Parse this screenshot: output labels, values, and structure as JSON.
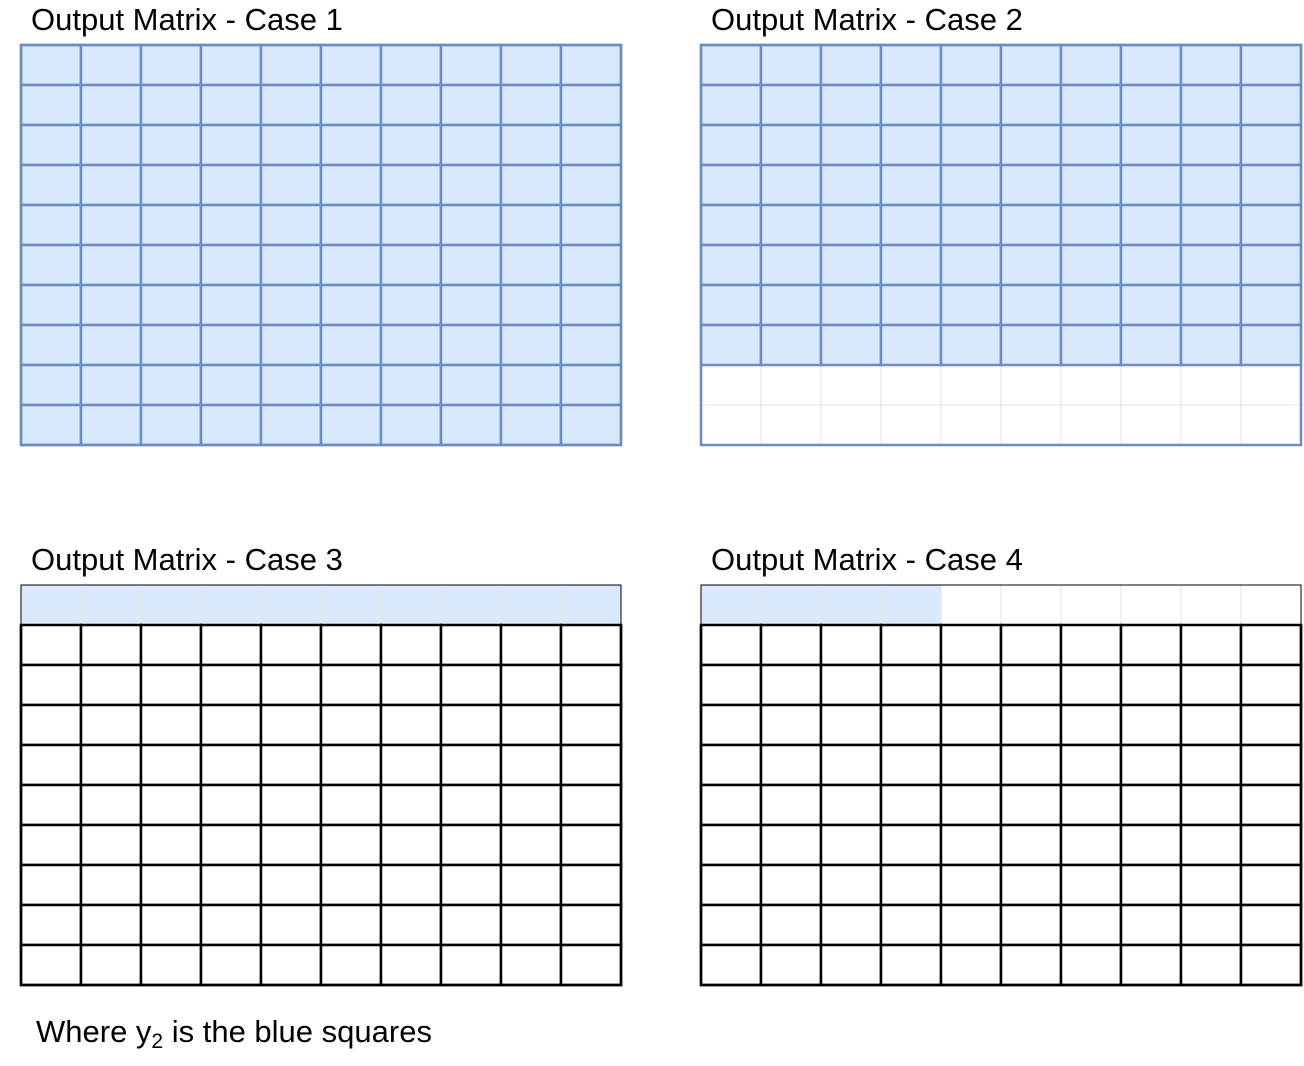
{
  "colors": {
    "fill": "#dae8fc",
    "blue_stroke": "#6c8ebf",
    "black_stroke": "#000000",
    "light_stroke": "#e3e3e3"
  },
  "panels": [
    {
      "title": "Output Matrix - Case 1",
      "rows": 10,
      "cols": 10,
      "blue_cells": {
        "full_rows": 10,
        "partial_row_cells": 0
      },
      "grid_style": "blue"
    },
    {
      "title": "Output Matrix - Case 2",
      "rows": 10,
      "cols": 10,
      "blue_cells": {
        "full_rows": 8,
        "partial_row_cells": 0
      },
      "grid_style": "blue-light"
    },
    {
      "title": "Output Matrix - Case 3",
      "rows": 10,
      "cols": 10,
      "blue_cells": {
        "full_rows": 1,
        "partial_row_cells": 0
      },
      "grid_style": "black"
    },
    {
      "title": "Output Matrix - Case 4",
      "rows": 10,
      "cols": 10,
      "blue_cells": {
        "full_rows": 0,
        "partial_row_cells": 4
      },
      "grid_style": "black"
    }
  ],
  "caption": {
    "prefix": "Where y",
    "subscript": "2",
    "suffix": " is the blue squares"
  }
}
